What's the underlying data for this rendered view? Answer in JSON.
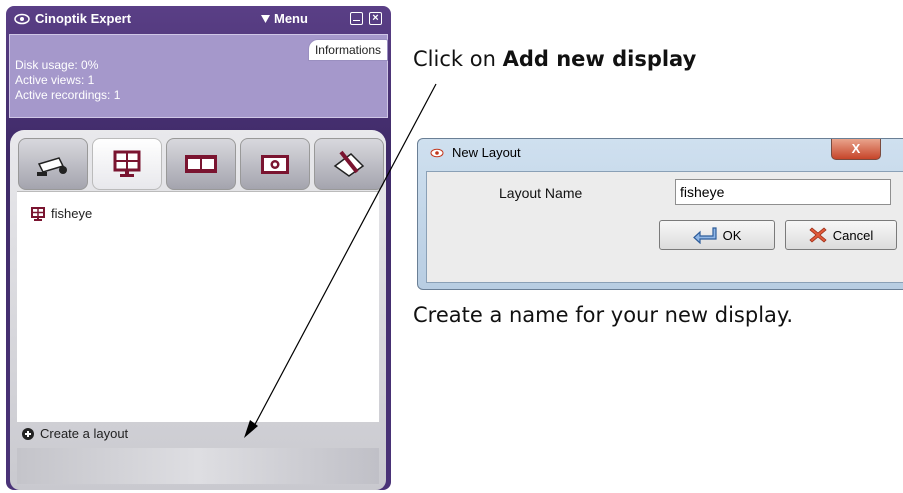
{
  "app": {
    "title": "Cinoptik Expert",
    "menu_label": "Menu",
    "info_tab": "Informations",
    "info_lines": [
      "Disk usage: 0%",
      "Active views: 1",
      "Active recordings: 1"
    ],
    "tabs": [
      {
        "name": "camera",
        "icon": "camera-icon"
      },
      {
        "name": "layouts",
        "icon": "display-icon",
        "active": true
      },
      {
        "name": "recordings",
        "icon": "film-icon"
      },
      {
        "name": "snapshots",
        "icon": "photo-icon"
      },
      {
        "name": "settings",
        "icon": "tools-icon"
      }
    ],
    "layout_items": [
      "fisheye"
    ],
    "create_layout_label": "Create a layout"
  },
  "instructions": {
    "top_prefix": "Click on ",
    "top_bold": "Add new display",
    "bottom": "Create a name for your new display."
  },
  "dialog": {
    "title": "New Layout",
    "close_label": "X",
    "field_label": "Layout Name",
    "field_value": "fisheye",
    "ok_label": "OK",
    "cancel_label": "Cancel"
  },
  "colors": {
    "window_purple": "#4a3378",
    "info_panel": "#a598cb",
    "dialog_frame": "#b8cde2"
  }
}
